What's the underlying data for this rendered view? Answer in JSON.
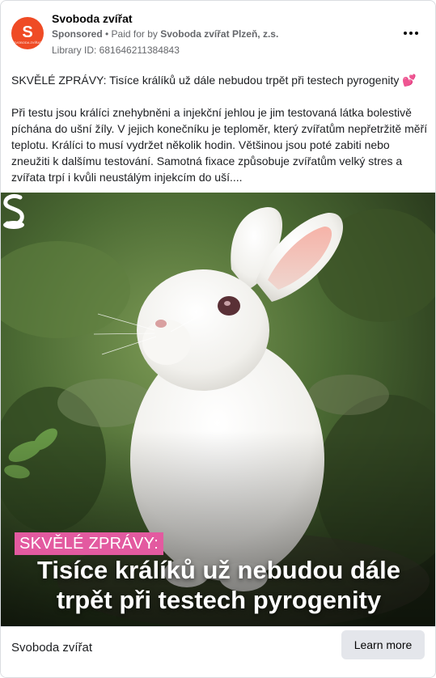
{
  "header": {
    "page_name": "Svoboda zvířat",
    "avatar_letter": "S",
    "avatar_caption": "SVOBODA ZVÍŘAT",
    "sponsored_label": "Sponsored",
    "separator": " • ",
    "paid_prefix": "Paid for by ",
    "paid_by": "Svoboda zvířat Plzeň, z.s.",
    "library_id": "Library ID: 681646211384843",
    "more_icon": "more-horizontal-icon"
  },
  "body": {
    "headline": "SKVĚLÉ ZPRÁVY: Tisíce králíků už dále nebudou trpět při testech pyrogenity",
    "headline_emoji": "💕",
    "paragraph": "Při testu jsou králíci znehybněni a injekční jehlou je jim testovaná látka bolestivě píchána do ušní žíly. V jejich konečníku je teploměr, který zvířatům nepřetržitě měří teplotu. Králíci to musí vydržet několik hodin. Většinou jsou poté zabiti nebo zneužiti k dalšímu testování. Samotná fixace způsobuje zvířatům velký stres a zvířata trpí i kvůli neustálým injekcím do uší...."
  },
  "creative": {
    "tag": "SKVĚLÉ ZPRÁVY:",
    "title_line1": "Tisíce králíků už nebudou dále",
    "title_line2": "trpět při testech pyrogenity",
    "tag_color": "#e35aa0",
    "logo_icon": "svoboda-logo-icon"
  },
  "footer": {
    "name": "Svoboda zvířat",
    "cta_label": "Learn more"
  },
  "colors": {
    "brand": "#ef4b25",
    "meta_text": "#65676b",
    "cta_bg": "#e4e6eb"
  }
}
